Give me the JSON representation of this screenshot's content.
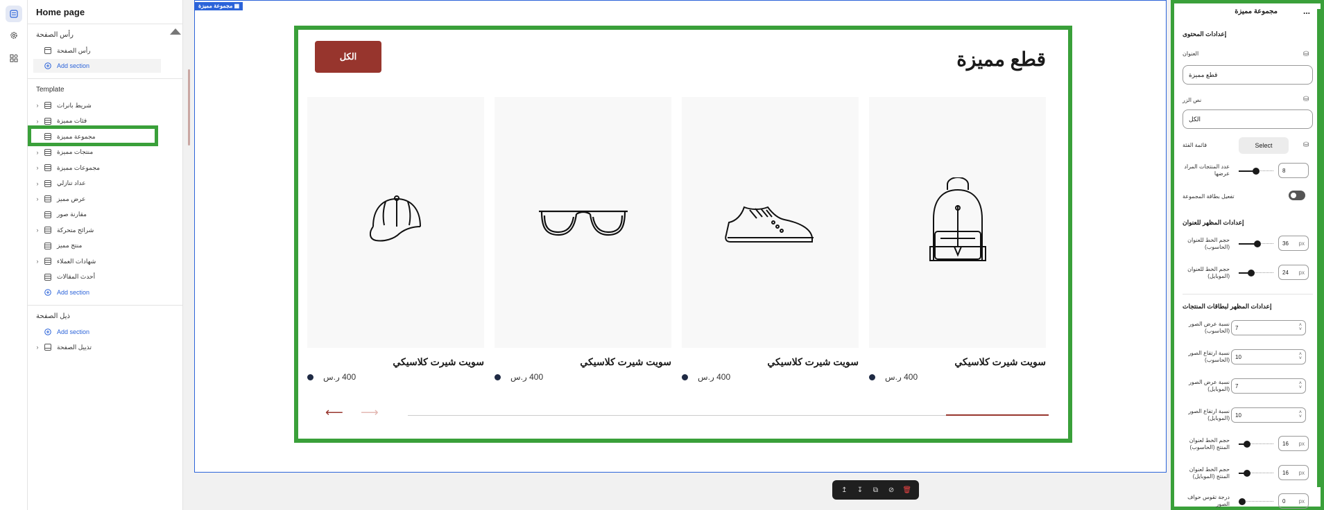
{
  "sidebar": {
    "title": "Home page",
    "header_group": {
      "label": "رأس الصفحة",
      "item": "رأس الصفحة",
      "add": "Add section"
    },
    "template_group": {
      "label": "Template",
      "items": [
        "شريط بانرات",
        "فئات مميزة",
        "مجموعة مميزة",
        "منتجات مميزة",
        "مجموعات مميزة",
        "عداد تنازلي",
        "عرض مميز",
        "مقارنة صور",
        "شرائح متحركة",
        "منتج مميز",
        "شهادات العملاء",
        "أحدث المقالات"
      ],
      "add": "Add section"
    },
    "footer_group": {
      "label": "ذيل الصفحة",
      "add": "Add section",
      "item": "تذييل الصفحة"
    }
  },
  "canvas": {
    "section_label": "مجموعة مميزة",
    "title": "قطع مميزة",
    "all_button": "الكل",
    "products": [
      {
        "name": "سويت شيرت كلاسيكي",
        "price": "400 ر.س",
        "icon": "backpack-icon"
      },
      {
        "name": "سويت شيرت كلاسيكي",
        "price": "400 ر.س",
        "icon": "sneaker-icon"
      },
      {
        "name": "سويت شيرت كلاسيكي",
        "price": "400 ر.س",
        "icon": "glasses-icon"
      },
      {
        "name": "سويت شيرت كلاسيكي",
        "price": "400 ر.س",
        "icon": "cap-icon"
      }
    ],
    "accent_color": "#97352d",
    "scroll_progress": 0.16
  },
  "toolbar": {
    "icons": [
      "move-up-icon",
      "move-down-icon",
      "duplicate-icon",
      "hide-icon",
      "delete-icon"
    ]
  },
  "panel": {
    "title": "مجموعة مميزة",
    "more": "...",
    "content_heading": "إعدادات المحتوى",
    "title_label": "العنوان",
    "title_value": "قطع مميزة",
    "button_label": "نص الزر",
    "button_value": "الكل",
    "category_label": "قائمة الفئة",
    "select_label": "Select",
    "count_label": "عدد المنتجات المراد عرضها",
    "count_value": "8",
    "count_fraction": 0.5,
    "collection_card_label": "تفعيل بطاقة المجموعة",
    "title_appearance_heading": "إعدادات المظهر للعنوان",
    "title_size_desktop_label": "حجم الخط للعنوان (الحاسوب)",
    "title_size_desktop_value": "36",
    "title_size_desktop_fraction": 0.55,
    "title_size_mobile_label": "حجم الخط للعنوان (الموبايل)",
    "title_size_mobile_value": "24",
    "title_size_mobile_fraction": 0.33,
    "cards_heading": "إعدادات المظهر لبطاقات المنتجات",
    "img_width_desktop_label": "نسبة عرض الصور (الحاسوب)",
    "img_width_desktop_value": "7",
    "img_height_desktop_label": "نسبة ارتفاع الصور (الحاسوب)",
    "img_height_desktop_value": "10",
    "img_width_mobile_label": "نسبة عرض الصور (الموبايل)",
    "img_width_mobile_value": "7",
    "img_height_mobile_label": "نسبة ارتفاع الصور (الموبايل)",
    "img_height_mobile_value": "10",
    "name_size_desktop_label": "حجم الخط لعنوان المنتج (الحاسوب)",
    "name_size_desktop_value": "16",
    "name_size_desktop_fraction": 0.18,
    "name_size_mobile_label": "حجم الخط لعنوان المنتج (الموبايل)",
    "name_size_mobile_value": "16",
    "name_size_mobile_fraction": 0.18,
    "radius_label": "درجة تقوس حواف الصور",
    "radius_value": "0",
    "radius_fraction": 0.0,
    "unit": "px"
  }
}
